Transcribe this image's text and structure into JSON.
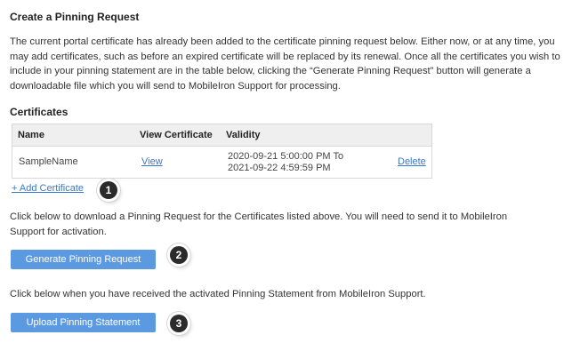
{
  "page": {
    "title": "Create a Pinning Request",
    "description": "The current portal certificate has already been added to the certificate pinning request below. Either now, or at any time, you may add certificates, such as before an expired certificate will be replaced by its renewal. Once all the certificates you wish to include in your pinning statement are in the table below, clicking the “Generate Pinning Request” button will generate a downloadable file which you will send to MobileIron Support for processing."
  },
  "certificates": {
    "heading": "Certificates",
    "columns": [
      "Name",
      "View Certificate",
      "Validity"
    ],
    "rows": [
      {
        "name": "SampleName",
        "view": "View",
        "validity_from": "2020-09-21 5:00:00 PM To",
        "validity_to": "2021-09-22 4:59:59 PM",
        "delete": "Delete"
      }
    ],
    "add_link": "+ Add Certificate"
  },
  "generate": {
    "text": "Click below to download a Pinning Request for the Certificates listed above. You will need to send it to MobileIron Support for activation.",
    "button": "Generate Pinning Request"
  },
  "upload": {
    "text": "Click below when you have received the activated Pinning Statement from MobileIron Support.",
    "button": "Upload Pinning Statement"
  },
  "badges": [
    "1",
    "2",
    "3"
  ],
  "colors": {
    "link": "#3a78c9",
    "button": "#5b9ae0",
    "badge": "#2b2b2b"
  }
}
